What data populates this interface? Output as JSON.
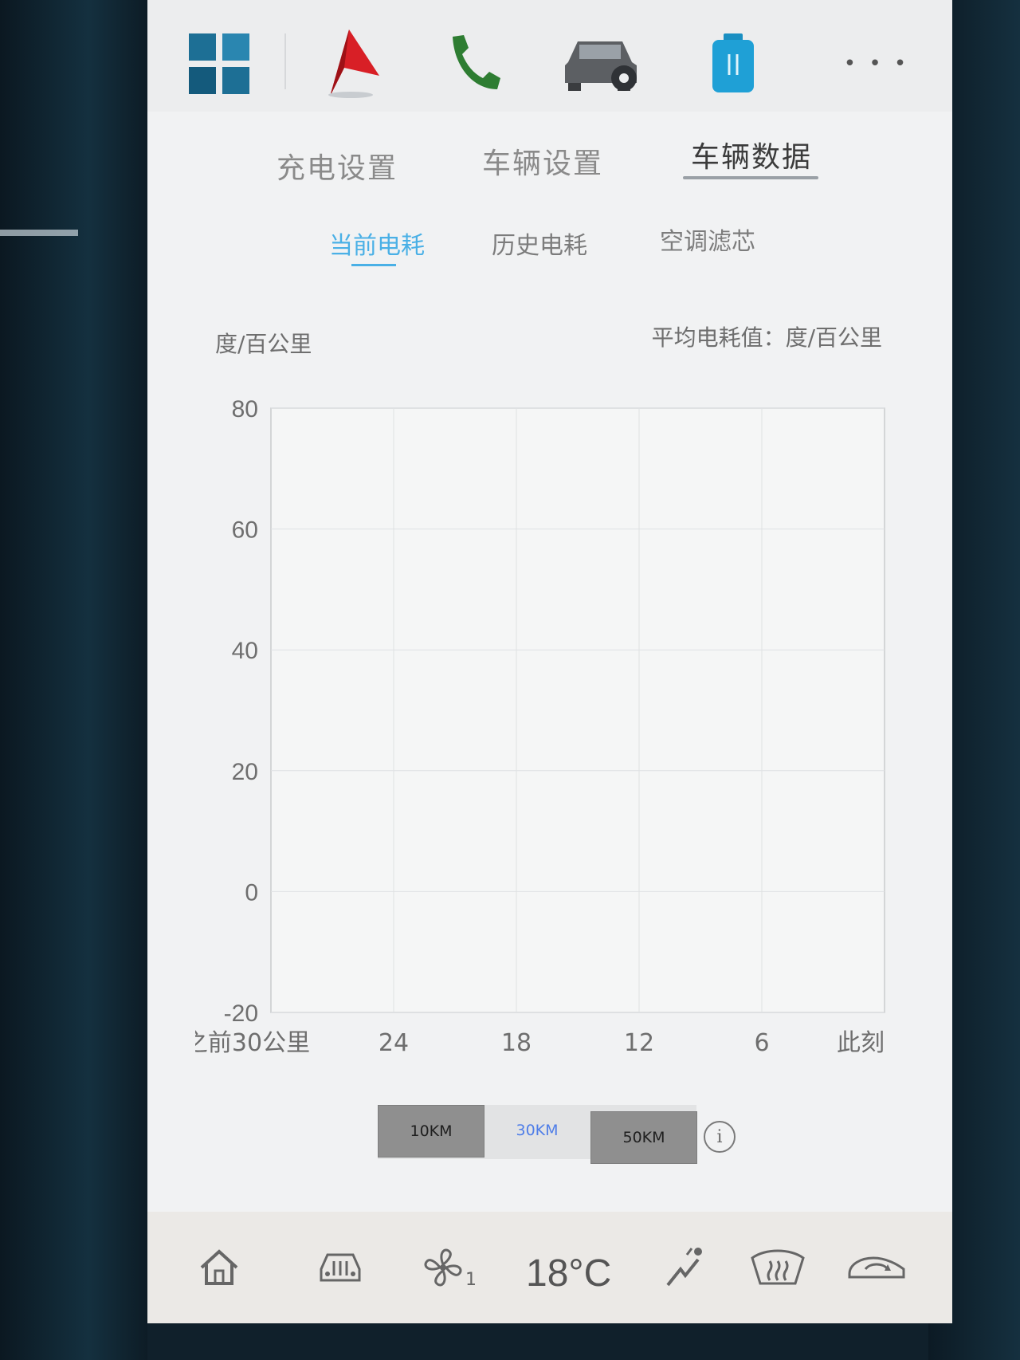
{
  "appbar": {
    "icons": [
      "apps-grid-icon",
      "navigation-icon",
      "phone-icon",
      "vehicle-settings-icon",
      "media-usb-icon"
    ],
    "more_label": "• • •"
  },
  "main_tabs": [
    {
      "label": "充电设置",
      "active": false
    },
    {
      "label": "车辆设置",
      "active": false
    },
    {
      "label": "车辆数据",
      "active": true
    }
  ],
  "sub_tabs": [
    {
      "label": "当前电耗",
      "active": true
    },
    {
      "label": "历史电耗",
      "active": false
    },
    {
      "label": "空调滤芯",
      "active": false
    }
  ],
  "chart_header": {
    "unit_label": "度/百公里",
    "average_label": "平均电耗值：度/百公里"
  },
  "chart_data": {
    "type": "line",
    "ylabel": "度/百公里",
    "y_ticks": [
      "80",
      "60",
      "40",
      "20",
      "0",
      "-20"
    ],
    "ylim": [
      -20,
      80
    ],
    "x_ticks": [
      "之前30公里",
      "24",
      "18",
      "12",
      "6",
      "此刻"
    ],
    "grid": true,
    "series": []
  },
  "range": {
    "options": [
      "10KM",
      "30KM",
      "50KM"
    ],
    "selected": "30KM"
  },
  "info_glyph": "i",
  "bottombar": {
    "icons": [
      "home-icon",
      "vehicle-control-icon",
      "fan-icon",
      "airflow-icon",
      "rear-defrost-icon",
      "recirculation-icon"
    ],
    "fan_level": "1",
    "temperature": "18°C"
  },
  "colors": {
    "accent": "#4ab0e6",
    "selected_range": "#4f7ee8",
    "button_gray": "#8f8f8f"
  }
}
